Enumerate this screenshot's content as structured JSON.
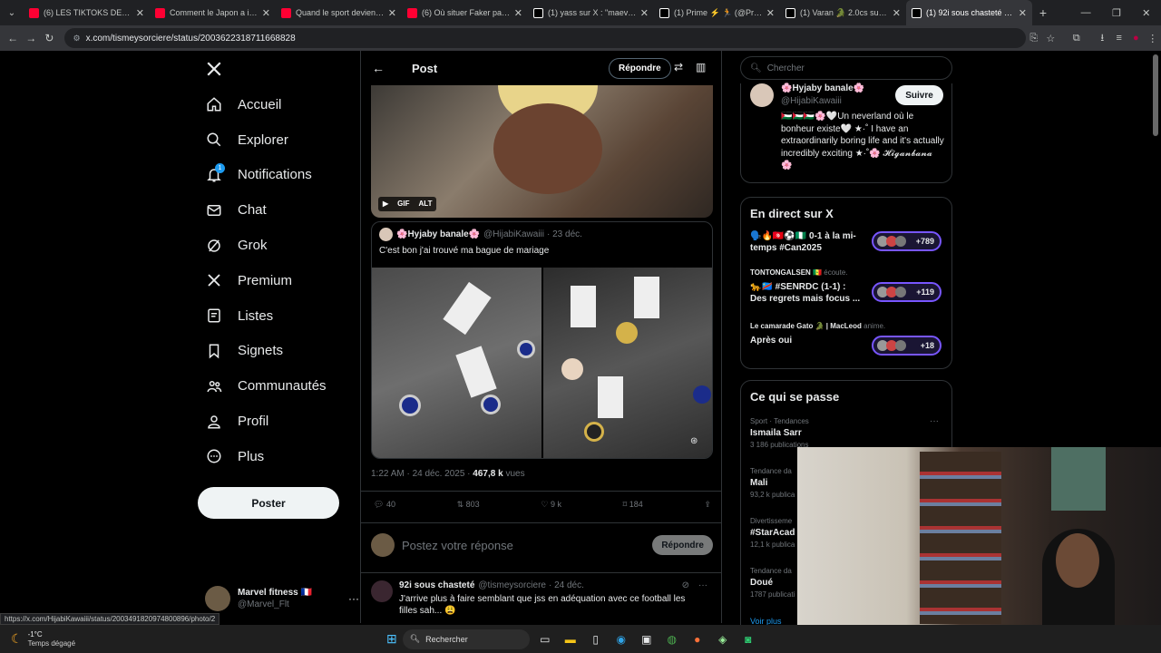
{
  "browser": {
    "tabs": [
      {
        "label": "(6) LES TIKTOKS DES POLI",
        "color": "#ff0033"
      },
      {
        "label": "Comment le Japon a inve",
        "color": "#ff0033"
      },
      {
        "label": "Quand le sport devient TC",
        "color": "#ff0033"
      },
      {
        "label": "(6) Où situer Faker parmi",
        "color": "#ff0033"
      },
      {
        "label": "(1) yass sur X : \"maeva gh",
        "color": "#ffffff"
      },
      {
        "label": "(1) Prime ⚡ 🏃 (@Prime",
        "color": "#ffffff"
      },
      {
        "label": "(1) Varan 🐊 2.0cs sur X :",
        "color": "#ffffff"
      },
      {
        "label": "(1) 92i sous chasteté sur X",
        "color": "#ffffff",
        "active": true
      }
    ],
    "url": "x.com/tismeysorciere/status/2003622318711668828",
    "status_url": "https://x.com/HijabiKawaiii/status/2003491820974800896/photo/2"
  },
  "nav": {
    "logo": "X",
    "items": [
      {
        "label": "Accueil",
        "icon": "home-icon"
      },
      {
        "label": "Explorer",
        "icon": "search-icon"
      },
      {
        "label": "Notifications",
        "icon": "bell-icon"
      },
      {
        "label": "Chat",
        "icon": "mail-icon"
      },
      {
        "label": "Grok",
        "icon": "grok-icon"
      },
      {
        "label": "Premium",
        "icon": "x-icon"
      },
      {
        "label": "Listes",
        "icon": "list-icon"
      },
      {
        "label": "Signets",
        "icon": "bookmark-icon"
      },
      {
        "label": "Communautés",
        "icon": "people-icon"
      },
      {
        "label": "Profil",
        "icon": "person-icon"
      },
      {
        "label": "Plus",
        "icon": "more-circle-icon"
      }
    ],
    "notif_badge": "1",
    "post_button": "Poster",
    "account": {
      "name": "Marvel fitness 🇫🇷",
      "handle": "@Marvel_Flt"
    }
  },
  "post": {
    "header_title": "Post",
    "reply_button": "Répondre",
    "gif_badge": "GIF",
    "alt_badge": "ALT",
    "quote": {
      "author": "🌸Hyjaby banale🌸",
      "handle": "@HijabiKawaiii",
      "date": "· 23 déc.",
      "text": "C'est bon j'ai trouvé ma bague de mariage"
    },
    "meta_time": "1:22 AM · 24 déc. 2025 · ",
    "views_count": "467,8 k",
    "views_label": " vues",
    "stats": {
      "replies": "40",
      "reposts": "803",
      "likes": "9 k",
      "bookmarks": "184"
    },
    "reply_placeholder": "Postez votre réponse",
    "reply_submit": "Répondre",
    "reply_item": {
      "author": "92i sous chasteté",
      "handle": "@tismeysorciere",
      "date": "· 24 déc.",
      "text": "J'arrive plus à faire semblant que jss en adéquation avec ce football les filles sah... 😩"
    }
  },
  "sidebar": {
    "search_placeholder": "Chercher",
    "profile": {
      "name": "🌸Hyjaby banale🌸",
      "handle": "@HijabiKawaiii",
      "follow": "Suivre",
      "bio": "🇵🇸🇵🇸🇵🇸🌸🤍Un neverland où le bonheur existe🤍 ★·˚ I have an extraordinarily boring life and it's actually incredibly exciting ★·˚🌸 𝓗𝓲𝓰𝓪𝓷𝓫𝓪𝓷𝓪 🌸"
    },
    "live_title": "En direct sur X",
    "live": [
      {
        "host": "",
        "status": "",
        "title": "🗣️🔥🇹🇳⚽🇳🇬 0-1 à la mi-temps #Can2025",
        "count": "+789"
      },
      {
        "host": "TONTONGALSEN 🇸🇳",
        "status": "écoute.",
        "title": "🐆🇨🇩 #SENRDC (1-1) : Des regrets mais focus ...",
        "count": "+119"
      },
      {
        "host": "Le camarade Gato 🐊 | MacLeod",
        "status": "anime.",
        "title": "Après oui",
        "count": "+18"
      }
    ],
    "trends_title": "Ce qui se passe",
    "trends": [
      {
        "context": "Sport · Tendances",
        "name": "Ismaila Sarr",
        "posts": "3 186 publications"
      },
      {
        "context": "Tendance da",
        "name": "Mali",
        "posts": "93,2 k publica"
      },
      {
        "context": "Divertisseme",
        "name": "#StarAcad",
        "posts": "12,1 k publica"
      },
      {
        "context": "Tendance da",
        "name": "Doué",
        "posts": "1787 publicati"
      }
    ],
    "show_more": "Voir plus"
  },
  "taskbar": {
    "temp": "-1°C",
    "weather": "Temps dégagé",
    "search": "Rechercher"
  },
  "colors": {
    "accent": "#1d9bf0",
    "bg": "#000000",
    "border": "#2f3336",
    "muted": "#71767b"
  }
}
